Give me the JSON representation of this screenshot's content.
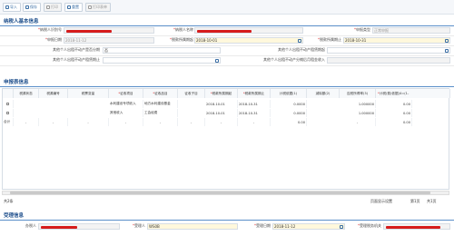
{
  "toolbar": {
    "import": "导入",
    "save": "保存",
    "print": "打印",
    "reset": "重置",
    "print_form": "打印表单"
  },
  "taxpayer_section": {
    "title": "纳税人基本信息",
    "taxpayer_id_label": "纳税人识别号",
    "taxpayer_name_label": "纳税人名称",
    "reg_type_label": "申报类型",
    "reg_type_value": "正常申报",
    "declare_date_label": "申报日期",
    "declare_date_value": "2018-11-12",
    "period_start_label": "税款所属期起",
    "period_start_value": "2018-10-01",
    "period_end_label": "税款所属期止",
    "period_end_value": "2018-10-31",
    "other_payee_label": "其他个人出租不动产是否分期",
    "other_payee_value": "否",
    "other_start_label": "其他个人出租不动产租赁期起",
    "other_end_label": "其他个人出租不动产租赁期止",
    "other_income_label": "其他个人出租不动产分摊后月租金收入"
  },
  "declare_section": {
    "title": "申报表信息",
    "columns": [
      "",
      "税源状态",
      "税源编号",
      "税票变量",
      "征收项目",
      "征收品目",
      "征收子目",
      "税款所属期起",
      "税款所属期止",
      "计税依据(1)",
      "减除额(2)",
      "应税所得率(3)",
      "计税(费)依据(4=(1-"
    ],
    "rows": [
      {
        "item": "水利建设专项收入",
        "sub": "地方水利建设基金",
        "start": "2018-10-01",
        "end": "2018-10-31",
        "basis": "0.0000",
        "rate": "1.000000",
        "tax": "0.00"
      },
      {
        "item": "其他收入",
        "sub": "工会经费",
        "start": "2018-10-01",
        "end": "2018-10-31",
        "basis": "0.0000",
        "rate": "1.000000",
        "tax": "0.00"
      }
    ],
    "total": {
      "label": "合计",
      "dashes": "-",
      "basis": "0.00",
      "rate": "-",
      "tax": "0.00"
    },
    "footer_left": "共2条",
    "footer_settings": "页面显示设置",
    "footer_page": "第1页",
    "footer_total": "共1页"
  },
  "accept_section": {
    "title": "受理信息",
    "agent_label": "办税人",
    "acceptor_label": "受理人",
    "acceptor_value": "WS0B",
    "accept_date_label": "受理日期",
    "accept_date_value": "2018-11-12",
    "tax_authority_label": "受理税务机关"
  }
}
